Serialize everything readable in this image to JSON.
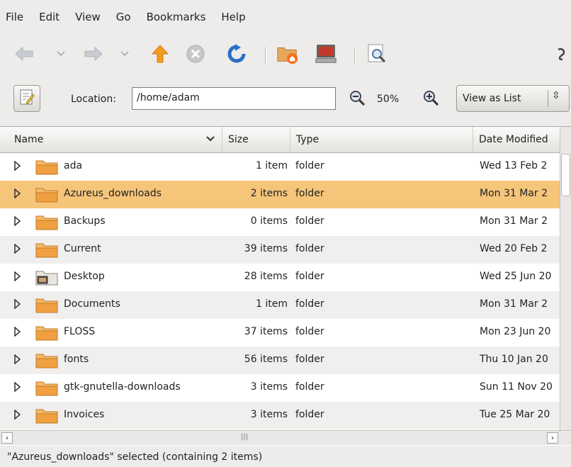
{
  "menubar": {
    "items": [
      {
        "label": "File"
      },
      {
        "label": "Edit"
      },
      {
        "label": "View"
      },
      {
        "label": "Go"
      },
      {
        "label": "Bookmarks"
      },
      {
        "label": "Help"
      }
    ]
  },
  "toolbar": {
    "icons": [
      "back-icon",
      "back-history-icon",
      "forward-icon",
      "forward-history-icon",
      "up-icon",
      "stop-icon",
      "reload-icon",
      "home-icon",
      "computer-icon",
      "search-icon",
      "throbber-icon"
    ]
  },
  "locationbar": {
    "label": "Location:",
    "value": "/home/adam",
    "zoom": "50%",
    "view_mode": "View as List"
  },
  "columns": {
    "name": "Name",
    "size": "Size",
    "type": "Type",
    "date": "Date Modified"
  },
  "rows": [
    {
      "name": "ada",
      "size": "1 item",
      "type": "folder",
      "date": "Wed 13 Feb 2"
    },
    {
      "name": "Azureus_downloads",
      "size": "2 items",
      "type": "folder",
      "date": "Mon 31 Mar 2"
    },
    {
      "name": "Backups",
      "size": "0 items",
      "type": "folder",
      "date": "Mon 31 Mar 2"
    },
    {
      "name": "Current",
      "size": "39 items",
      "type": "folder",
      "date": "Wed 20 Feb 2"
    },
    {
      "name": "Desktop",
      "size": "28 items",
      "type": "folder",
      "date": "Wed 25 Jun 20"
    },
    {
      "name": "Documents",
      "size": "1 item",
      "type": "folder",
      "date": "Mon 31 Mar 2"
    },
    {
      "name": "FLOSS",
      "size": "37 items",
      "type": "folder",
      "date": "Mon 23 Jun 20"
    },
    {
      "name": "fonts",
      "size": "56 items",
      "type": "folder",
      "date": "Thu 10 Jan 20"
    },
    {
      "name": "gtk-gnutella-downloads",
      "size": "3 items",
      "type": "folder",
      "date": "Sun 11 Nov 20"
    },
    {
      "name": "Invoices",
      "size": "3 items",
      "type": "folder",
      "date": "Tue 25 Mar 20"
    }
  ],
  "selected_row": "Azureus_downloads",
  "status": "\"Azureus_downloads\" selected (containing 2 items)",
  "colors": {
    "selection": "#f5c57a",
    "alt_row": "#f0efee",
    "background": "#edeceb",
    "folder": "#f0a040"
  }
}
